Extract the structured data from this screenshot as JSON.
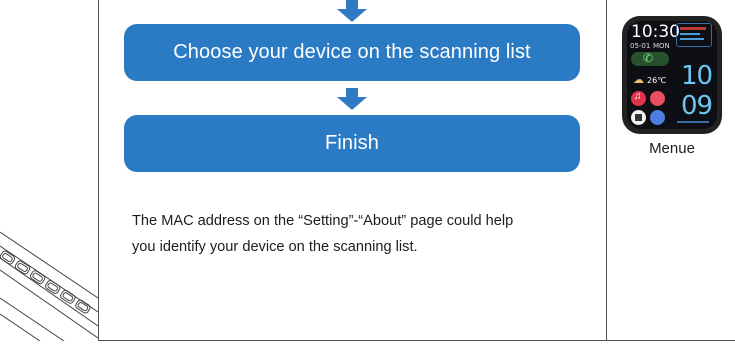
{
  "flow": {
    "steps": [
      {
        "label": "Choose your device on the scanning list"
      },
      {
        "label": "Finish"
      }
    ]
  },
  "note": {
    "line1": "The MAC address on the “Setting”-“About” page could help",
    "line2": "you identify your device on the scanning list."
  },
  "watch": {
    "time": "10:30",
    "date": "05-01",
    "weekday": "MON",
    "temperature": "26℃",
    "hour_big": "10",
    "minute_big": "09",
    "caption": "Menue"
  },
  "colors": {
    "step_fill": "#2a7ac4",
    "arrow": "#2f7cc5"
  }
}
